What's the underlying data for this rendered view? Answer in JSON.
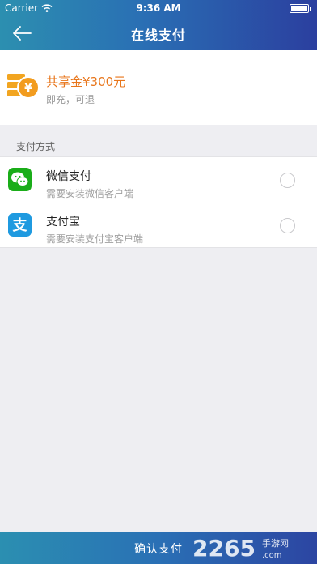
{
  "status_bar": {
    "carrier": "Carrier",
    "time": "9:36 AM"
  },
  "nav": {
    "title": "在线支付",
    "back_icon": "arrow-left-icon"
  },
  "amount_card": {
    "title": "共享金¥300元",
    "subtitle": "即充，可退",
    "icon": "coin-stack-icon",
    "accent_color": "#e8751a"
  },
  "section_label": "支付方式",
  "payment_methods": [
    {
      "name": "微信支付",
      "description": "需要安装微信客户端",
      "icon": "wechat-icon",
      "color": "#1aad19",
      "selected": false
    },
    {
      "name": "支付宝",
      "description": "需要安装支付宝客户端",
      "icon": "alipay-icon",
      "color": "#1f9ae0",
      "selected": false
    }
  ],
  "confirm_button": {
    "label": "确认支付"
  },
  "watermark": {
    "text": "2265.com 手游网"
  }
}
